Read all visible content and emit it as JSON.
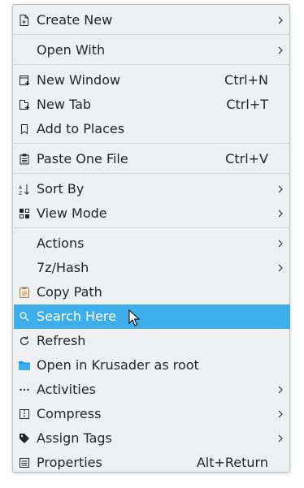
{
  "menu": {
    "items": {
      "create_new": {
        "label": "Create New"
      },
      "open_with": {
        "label": "Open With"
      },
      "new_window": {
        "label": "New Window",
        "shortcut": "Ctrl+N"
      },
      "new_tab": {
        "label": "New Tab",
        "shortcut": "Ctrl+T"
      },
      "add_to_places": {
        "label": "Add to Places"
      },
      "paste_one_file": {
        "label": "Paste One File",
        "shortcut": "Ctrl+V"
      },
      "sort_by": {
        "label": "Sort By"
      },
      "view_mode": {
        "label": "View Mode"
      },
      "actions": {
        "label": "Actions"
      },
      "hash_7z": {
        "label": "7z/Hash"
      },
      "copy_path": {
        "label": "Copy Path"
      },
      "search_here": {
        "label": "Search Here"
      },
      "refresh": {
        "label": "Refresh"
      },
      "open_krusader_root": {
        "label": "Open in Krusader as root"
      },
      "activities": {
        "label": "Activities"
      },
      "compress": {
        "label": "Compress"
      },
      "assign_tags": {
        "label": "Assign Tags"
      },
      "properties": {
        "label": "Properties",
        "shortcut": "Alt+Return"
      }
    },
    "highlighted_item": "Search Here"
  },
  "colors": {
    "menu_background": "#eff0f1",
    "highlight": "#3daee9",
    "text": "#232627",
    "separator": "#d3d5d7",
    "folder_blue": "#1d99f3"
  }
}
